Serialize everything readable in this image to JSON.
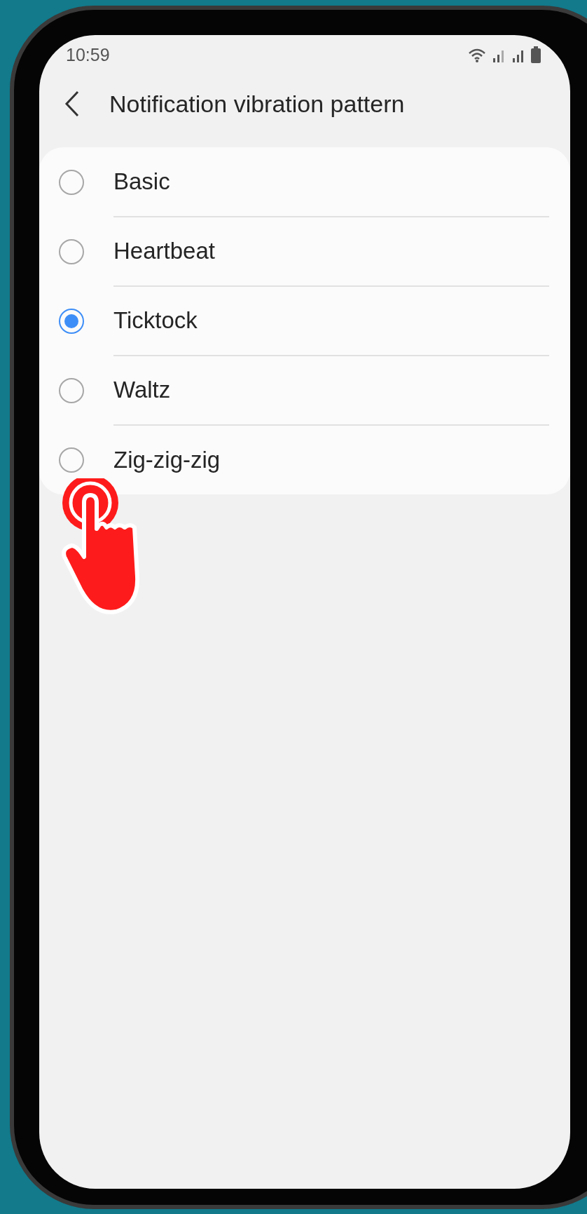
{
  "status_bar": {
    "time": "10:59"
  },
  "header": {
    "title": "Notification vibration pattern"
  },
  "options": [
    {
      "label": "Basic",
      "selected": false
    },
    {
      "label": "Heartbeat",
      "selected": false
    },
    {
      "label": "Ticktock",
      "selected": true
    },
    {
      "label": "Waltz",
      "selected": false
    },
    {
      "label": "Zig-zig-zig",
      "selected": false
    }
  ]
}
